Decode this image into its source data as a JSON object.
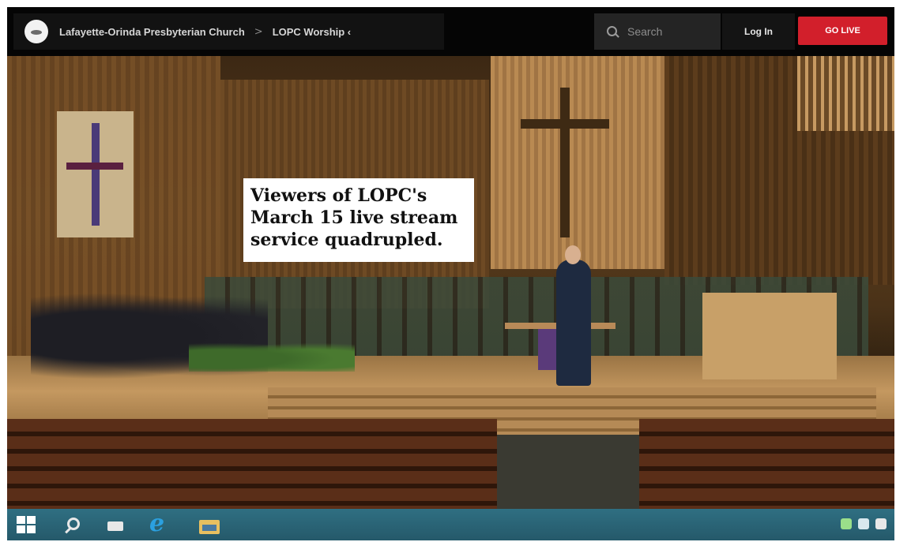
{
  "header": {
    "breadcrumb": {
      "church": "Lafayette-Orinda Presbyterian Church",
      "separator": ">",
      "page": "LOPC Worship ‹"
    },
    "search": {
      "placeholder": "Search"
    },
    "login_label": "Log In",
    "go_live_label": "GO LIVE",
    "go_live_color": "#d21f2b"
  },
  "caption": {
    "text": "Viewers of LOPC's March 15 live stream service quadrupled."
  },
  "taskbar": {
    "icons": [
      "windows-start-icon",
      "search-icon",
      "task-view-icon",
      "internet-explorer-icon",
      "file-explorer-icon"
    ],
    "ie_glyph": "e",
    "tray_icons": [
      "network-icon",
      "volume-icon",
      "notification-icon"
    ]
  }
}
